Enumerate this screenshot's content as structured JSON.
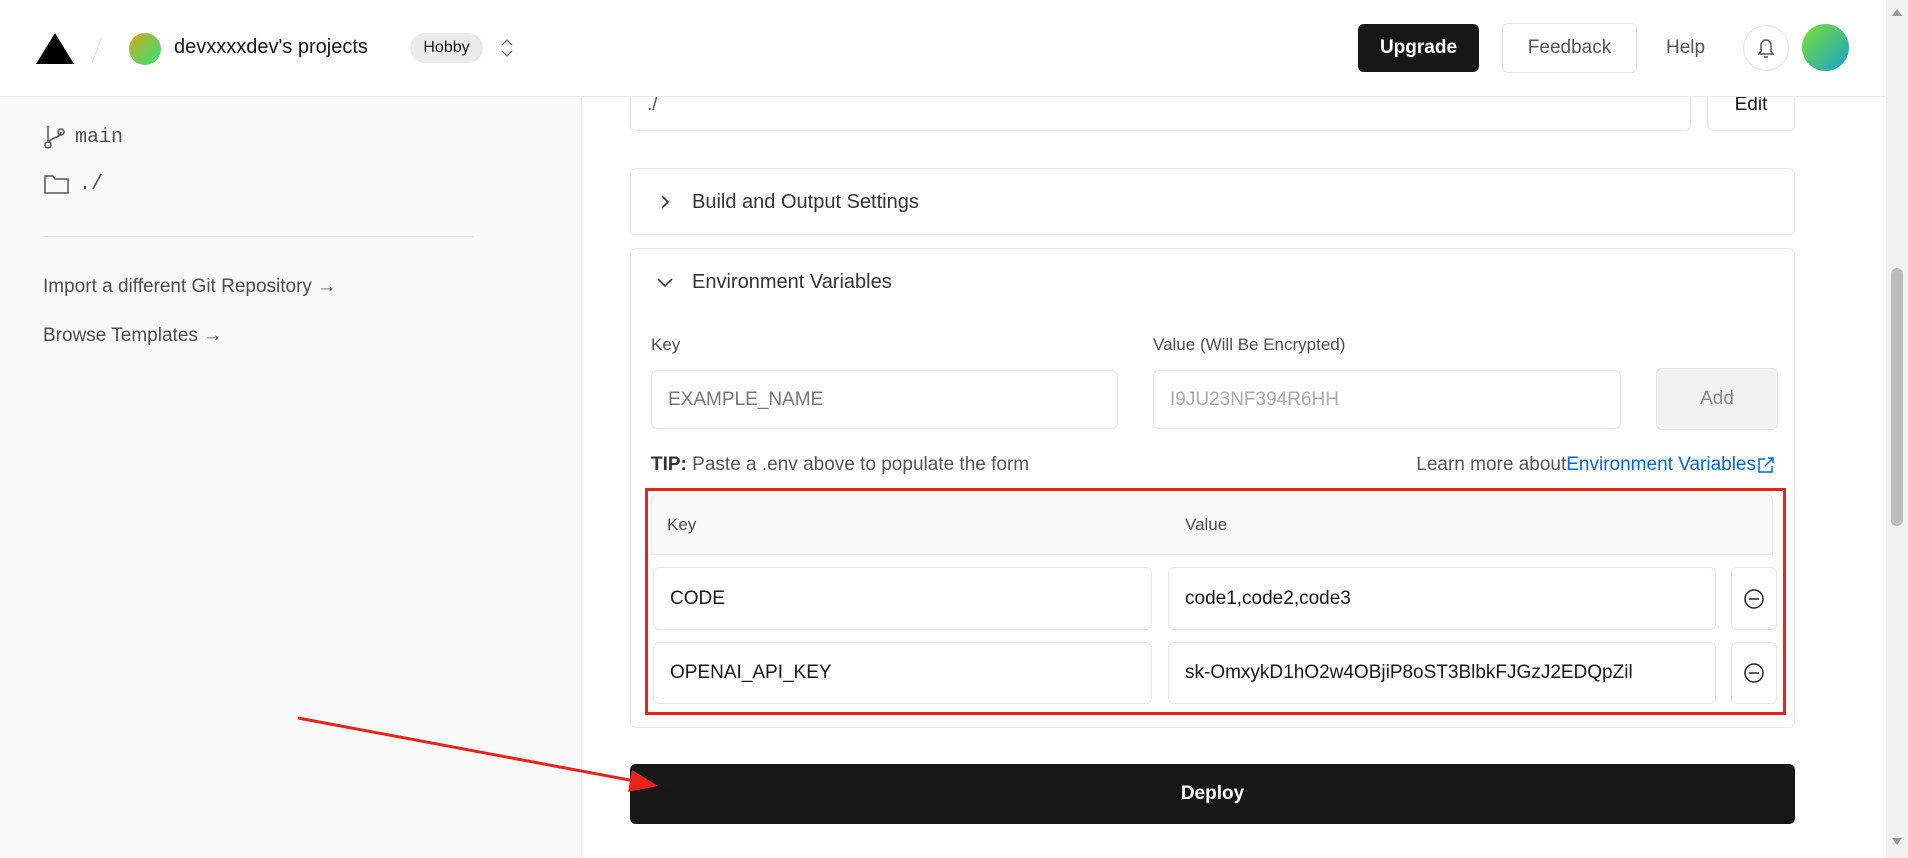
{
  "header": {
    "team": "devxxxxdev's projects",
    "plan_badge": "Hobby",
    "upgrade": "Upgrade",
    "feedback": "Feedback",
    "help": "Help"
  },
  "sidebar": {
    "branch": "main",
    "directory": "./",
    "import_link": "Import a different Git Repository →",
    "templates_link": "Browse Templates →"
  },
  "root_directory": {
    "value": "./",
    "edit": "Edit"
  },
  "build_settings": {
    "title": "Build and Output Settings"
  },
  "env": {
    "title": "Environment Variables",
    "key_label": "Key",
    "value_label": "Value (Will Be Encrypted)",
    "key_placeholder": "EXAMPLE_NAME",
    "value_placeholder": "I9JU23NF394R6HH",
    "add": "Add",
    "tip_bold": "TIP:",
    "tip": " Paste a .env above to populate the form",
    "learn_more": "Learn more about ",
    "learn_link": "Environment Variables",
    "table": {
      "key_header": "Key",
      "value_header": "Value",
      "rows": [
        {
          "key": "CODE",
          "value": "code1,code2,code3"
        },
        {
          "key": "OPENAI_API_KEY",
          "value": "sk-OmxykD1hO2w4OBjiP8oST3BlbkFJGzJ2EDQpZil"
        }
      ]
    }
  },
  "deploy": "Deploy",
  "colors": {
    "annotation": "#e8231c",
    "link": "#0068d6",
    "primary": "#171717"
  }
}
